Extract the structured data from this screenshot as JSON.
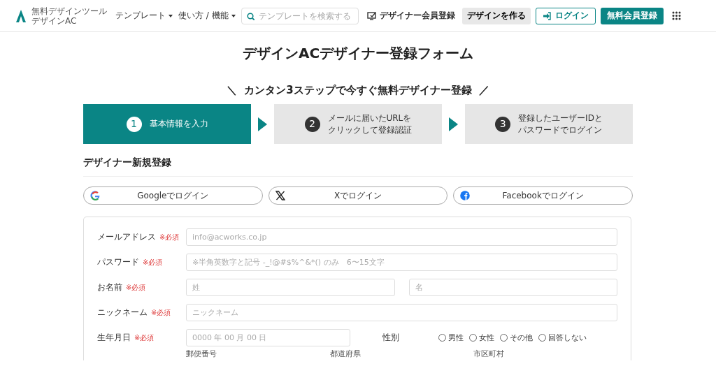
{
  "header": {
    "logo_lines": [
      "無料デザインツール",
      "デザインAC"
    ],
    "nav": [
      {
        "label": "テンプレート"
      },
      {
        "label": "使い方 / 機能"
      }
    ],
    "search": {
      "placeholder": "テンプレートを検索する"
    },
    "designer_register": "デザイナー会員登録",
    "create_button": "デザインを作る",
    "login_button": "ログイン",
    "signup_button": "無料会員登録"
  },
  "page_title": "デザインACデザイナー登録フォーム",
  "tagline": {
    "left": "＼",
    "text": "カンタン3ステップで今すぐ無料デザイナー登録",
    "right": "／"
  },
  "steps": [
    {
      "number": "1",
      "lines": [
        "基本情報を入力"
      ],
      "selected": true
    },
    {
      "number": "2",
      "lines": [
        "メールに届いたURLを",
        "クリックして登録認証"
      ],
      "selected": false
    },
    {
      "number": "3",
      "lines": [
        "登録したユーザーIDと",
        "パスワードでログイン"
      ],
      "selected": false
    }
  ],
  "section_title": "デザイナー新規登録",
  "social": [
    {
      "kind": "google",
      "label": "Googleでログイン"
    },
    {
      "kind": "x",
      "label": "Xでログイン"
    },
    {
      "kind": "facebook",
      "label": "Facebookでログイン"
    }
  ],
  "form": {
    "fields": [
      {
        "kind": "text",
        "label": "メールアドレス",
        "required": "※必須",
        "placeholders": [
          "info@acworks.co.jp"
        ]
      },
      {
        "kind": "text",
        "label": "パスワード",
        "required": "※必須",
        "placeholders": [
          "※半角英数字と記号 -_!@#$%^&*() のみ　6〜15文字"
        ]
      },
      {
        "kind": "text",
        "label": "お名前",
        "required": "※必須",
        "placeholders": [
          "姓",
          "名"
        ]
      },
      {
        "kind": "text",
        "label": "ニックネーム",
        "required": "※必須",
        "placeholders": [
          "ニックネーム"
        ]
      },
      {
        "kind": "date_gender",
        "label": "生年月日",
        "required": "※必須",
        "placeholders": [
          "0000 年 00 月 00 日"
        ],
        "gender_label": "性別",
        "options": [
          {
            "label": "男性",
            "selected": false
          },
          {
            "label": "女性",
            "selected": false
          },
          {
            "label": "その他",
            "selected": false
          },
          {
            "label": "回答しない",
            "selected": false
          }
        ]
      }
    ],
    "address_labels": [
      "郵便番号",
      "都道府県",
      "市区町村"
    ]
  }
}
